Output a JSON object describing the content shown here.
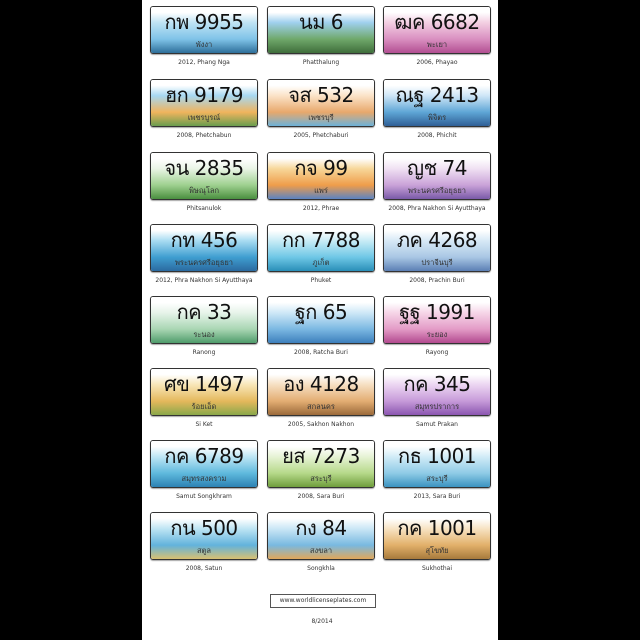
{
  "plates": [
    {
      "number": "กพ 9955",
      "province": "พังงา",
      "caption": "2012, Phang Nga",
      "colors": [
        "#bfe3f4",
        "#7fc3e8",
        "#2e6f9a"
      ]
    },
    {
      "number": "นม 6",
      "province": "",
      "caption": "Phatthalung",
      "colors": [
        "#9fd0ee",
        "#6fa86a",
        "#3f6e3b"
      ]
    },
    {
      "number": "ฒค 6682",
      "province": "พะเยา",
      "caption": "2006, Phayao",
      "colors": [
        "#f3cfe2",
        "#d98fc0",
        "#b24f92"
      ]
    },
    {
      "number": "ฮก 9179",
      "province": "เพชรบูรณ์",
      "caption": "2008, Phetchabun",
      "colors": [
        "#a7d8f2",
        "#f0b45d",
        "#6a9d4f"
      ]
    },
    {
      "number": "จส 532",
      "province": "เพชรบุรี",
      "caption": "2005, Phetchaburi",
      "colors": [
        "#fbe3c8",
        "#e8a86c",
        "#6db1d8"
      ]
    },
    {
      "number": "ณฐ 2413",
      "province": "พิจิตร",
      "caption": "2008, Phichit",
      "colors": [
        "#cfe6f7",
        "#5ea6d6",
        "#2f5f96"
      ]
    },
    {
      "number": "จน 2835",
      "province": "พิษณุโลก",
      "caption": "Phitsanulok",
      "colors": [
        "#eaf5e6",
        "#9ed08f",
        "#4a8f3f"
      ]
    },
    {
      "number": "กจ 99",
      "province": "แพร่",
      "caption": "2012, Phrae",
      "colors": [
        "#f7d79a",
        "#ef9d4a",
        "#5b83c2"
      ]
    },
    {
      "number": "ญช 74",
      "province": "พระนครศรีอยุธยา",
      "caption": "2008, Phra Nakhon Si Ayutthaya",
      "colors": [
        "#f0e1f3",
        "#c9a2d8",
        "#7a5aa8"
      ]
    },
    {
      "number": "กท 456",
      "province": "พระนครศรีอยุธยา",
      "caption": "2012, Phra Nakhon Si Ayutthaya",
      "colors": [
        "#a9dcf2",
        "#3f9ed0",
        "#2b6aa0"
      ]
    },
    {
      "number": "กก 7788",
      "province": "ภูเก็ต",
      "caption": "Phuket",
      "colors": [
        "#c9ecf6",
        "#6fc7e6",
        "#2a8fb8"
      ]
    },
    {
      "number": "ภค 4268",
      "province": "ปราจีนบุรี",
      "caption": "2008, Prachin Buri",
      "colors": [
        "#d7e9f6",
        "#a9c7e4",
        "#5b7fb4"
      ]
    },
    {
      "number": "กค 33",
      "province": "ระนอง",
      "caption": "Ranong",
      "colors": [
        "#e7f4ea",
        "#a9d6b3",
        "#4f9c6b"
      ]
    },
    {
      "number": "ฐก 65",
      "province": "",
      "caption": "2008, Ratcha Buri",
      "colors": [
        "#cfe8f7",
        "#7bb8e2",
        "#3d7fbc"
      ]
    },
    {
      "number": "ฐฐ 1991",
      "province": "ระยอง",
      "caption": "Rayong",
      "colors": [
        "#f6d6e8",
        "#e39bc6",
        "#b24a8f"
      ]
    },
    {
      "number": "ศข 1497",
      "province": "ร้อยเอ็ด",
      "caption": "Si Ket",
      "colors": [
        "#f8e6b8",
        "#e4b85c",
        "#8aa84a"
      ]
    },
    {
      "number": "อง 4128",
      "province": "สกลนคร",
      "caption": "2005, Sakhon Nakhon",
      "colors": [
        "#f6dfc2",
        "#e3ad72",
        "#9b6a3a"
      ]
    },
    {
      "number": "กค 345",
      "province": "สมุทรปราการ",
      "caption": "Samut Prakan",
      "colors": [
        "#ecd6f2",
        "#c69ad9",
        "#8b56b0"
      ]
    },
    {
      "number": "กค 6789",
      "province": "สมุทรสงคราม",
      "caption": "Samut Songkhram",
      "colors": [
        "#bfe6f5",
        "#5fb9dd",
        "#2c82b3"
      ]
    },
    {
      "number": "ยส 7273",
      "province": "สระบุรี",
      "caption": "2008, Sara Buri",
      "colors": [
        "#e6f3d5",
        "#b6d98a",
        "#6f9e3c"
      ]
    },
    {
      "number": "กธ 1001",
      "province": "สระบุรี",
      "caption": "2013, Sara Buri",
      "colors": [
        "#d2ecf7",
        "#8fcbe6",
        "#3b93c0"
      ]
    },
    {
      "number": "กน 500",
      "province": "สตูล",
      "caption": "2008, Satun",
      "colors": [
        "#bfe5f4",
        "#62b3dc",
        "#d9c070"
      ]
    },
    {
      "number": "กง 84",
      "province": "สงขลา",
      "caption": "Songkhla",
      "colors": [
        "#cbe7f6",
        "#79b9e0",
        "#e1a75a"
      ]
    },
    {
      "number": "กค 1001",
      "province": "สุโขทัย",
      "caption": "Sukhothai",
      "colors": [
        "#f7e3c3",
        "#e2b06a",
        "#a77a3c"
      ]
    }
  ],
  "footer": {
    "website": "www.worldlicenseplates.com",
    "date": "8/2014"
  }
}
